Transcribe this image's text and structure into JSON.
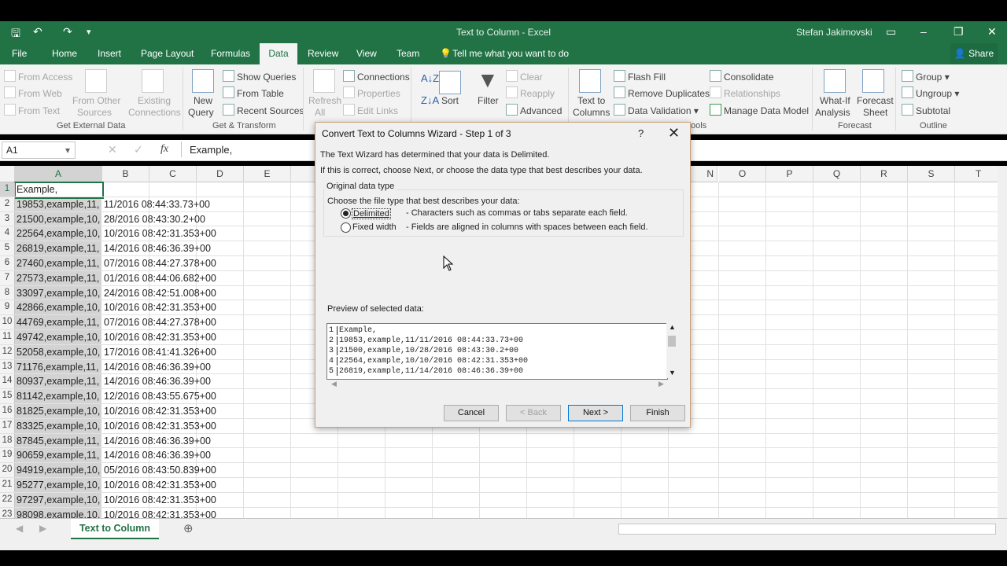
{
  "window": {
    "title": "Text to Column - Excel",
    "user": "Stefan Jakimovski"
  },
  "menu": [
    "File",
    "Home",
    "Insert",
    "Page Layout",
    "Formulas",
    "Data",
    "Review",
    "View",
    "Team"
  ],
  "tell_me": "Tell me what you want to do",
  "share_label": "Share",
  "ribbon": {
    "get_external": {
      "from_access": "From Access",
      "from_web": "From Web",
      "from_text": "From Text",
      "from_other_1": "From Other",
      "from_other_2": "Sources",
      "existing_1": "Existing",
      "existing_2": "Connections",
      "group": "Get External Data"
    },
    "get_transform": {
      "new_query_1": "New",
      "new_query_2": "Query",
      "show_queries": "Show Queries",
      "from_table": "From Table",
      "recent_sources": "Recent Sources",
      "group": "Get & Transform"
    },
    "connections": {
      "refresh_1": "Refresh",
      "refresh_2": "All",
      "connections": "Connections",
      "properties": "Properties",
      "edit_links": "Edit Links"
    },
    "sort_filter": {
      "sort": "Sort",
      "filter": "Filter",
      "clear": "Clear",
      "reapply": "Reapply",
      "advanced": "Advanced"
    },
    "data_tools": {
      "ttc_1": "Text to",
      "ttc_2": "Columns",
      "flash_fill": "Flash Fill",
      "remove_dup": "Remove Duplicates",
      "validation": "Data Validation",
      "consolidate": "Consolidate",
      "relationships": "Relationships",
      "manage_model": "Manage Data Model",
      "group_frag": "ools"
    },
    "forecast": {
      "whatif_1": "What-If",
      "whatif_2": "Analysis",
      "sheet_1": "Forecast",
      "sheet_2": "Sheet",
      "group": "Forecast"
    },
    "outline": {
      "group_btn": "Group",
      "ungroup": "Ungroup",
      "subtotal": "Subtotal",
      "group": "Outline"
    }
  },
  "formula_bar": {
    "name_box": "A1",
    "fx": "fx",
    "content": "Example,"
  },
  "columns": [
    "A",
    "B",
    "C",
    "D",
    "E",
    "N",
    "O",
    "P",
    "Q",
    "R",
    "S",
    "T"
  ],
  "rows": [
    {
      "n": "1",
      "a": "Example,",
      "b": ""
    },
    {
      "n": "2",
      "a": "19853,example,11,",
      "b": "11/2016 08:44:33.73+00"
    },
    {
      "n": "3",
      "a": "21500,example,10,",
      "b": "28/2016 08:43:30.2+00"
    },
    {
      "n": "4",
      "a": "22564,example,10,",
      "b": "10/2016 08:42:31.353+00"
    },
    {
      "n": "5",
      "a": "26819,example,11,",
      "b": "14/2016 08:46:36.39+00"
    },
    {
      "n": "6",
      "a": "27460,example,11,",
      "b": "07/2016 08:44:27.378+00"
    },
    {
      "n": "7",
      "a": "27573,example,11,",
      "b": "01/2016 08:44:06.682+00"
    },
    {
      "n": "8",
      "a": "33097,example,10,",
      "b": "24/2016 08:42:51.008+00"
    },
    {
      "n": "9",
      "a": "42866,example,10,",
      "b": "10/2016 08:42:31.353+00"
    },
    {
      "n": "10",
      "a": "44769,example,11,",
      "b": "07/2016 08:44:27.378+00"
    },
    {
      "n": "11",
      "a": "49742,example,10,",
      "b": "10/2016 08:42:31.353+00"
    },
    {
      "n": "12",
      "a": "52058,example,10,",
      "b": "17/2016 08:41:41.326+00"
    },
    {
      "n": "13",
      "a": "71176,example,11,",
      "b": "14/2016 08:46:36.39+00"
    },
    {
      "n": "14",
      "a": "80937,example,11,",
      "b": "14/2016 08:46:36.39+00"
    },
    {
      "n": "15",
      "a": "81142,example,10,",
      "b": "12/2016 08:43:55.675+00"
    },
    {
      "n": "16",
      "a": "81825,example,10,",
      "b": "10/2016 08:42:31.353+00"
    },
    {
      "n": "17",
      "a": "83325,example,10,",
      "b": "10/2016 08:42:31.353+00"
    },
    {
      "n": "18",
      "a": "87845,example,11,",
      "b": "14/2016 08:46:36.39+00"
    },
    {
      "n": "19",
      "a": "90659,example,11,",
      "b": "14/2016 08:46:36.39+00"
    },
    {
      "n": "20",
      "a": "94919,example,10,",
      "b": "05/2016 08:43:50.839+00"
    },
    {
      "n": "21",
      "a": "95277,example,10,",
      "b": "10/2016 08:42:31.353+00"
    },
    {
      "n": "22",
      "a": "97297,example,10,",
      "b": "10/2016 08:42:31.353+00"
    },
    {
      "n": "23",
      "a": "98098,example,10,",
      "b": "10/2016 08:42:31.353+00"
    }
  ],
  "sheet_tab": "Text to Column",
  "dialog": {
    "title": "Convert Text to Columns Wizard - Step 1 of 3",
    "help": "?",
    "line1": "The Text Wizard has determined that your data is Delimited.",
    "line2": "If this is correct, choose Next, or choose the data type that best describes your data.",
    "group_label": "Original data type",
    "choose_label": "Choose the file type that best describes your data:",
    "opt_delimited": "Delimited",
    "desc_delimited": "- Characters such as commas or tabs separate each field.",
    "opt_fixed": "Fixed width",
    "desc_fixed": "- Fields are aligned in columns with spaces between each field.",
    "preview_label": "Preview of selected data:",
    "preview": [
      {
        "n": "1",
        "t": "Example,"
      },
      {
        "n": "2",
        "t": "19853,example,11/11/2016 08:44:33.73+00"
      },
      {
        "n": "3",
        "t": "21500,example,10/28/2016 08:43:30.2+00"
      },
      {
        "n": "4",
        "t": "22564,example,10/10/2016 08:42:31.353+00"
      },
      {
        "n": "5",
        "t": "26819,example,11/14/2016 08:46:36.39+00"
      }
    ],
    "btn_cancel": "Cancel",
    "btn_back": "< Back",
    "btn_next": "Next >",
    "btn_finish": "Finish"
  },
  "colors": {
    "excel_green": "#217346"
  }
}
